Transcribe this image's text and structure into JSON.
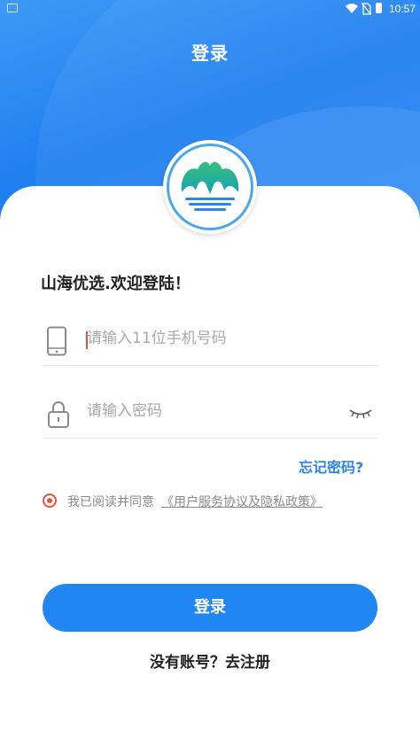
{
  "status_bar": {
    "time": "10:57",
    "icons": [
      "notification-icon",
      "wifi-icon",
      "no-sim-icon",
      "battery-icon"
    ]
  },
  "header": {
    "title": "登录"
  },
  "logo": {
    "icon": "app-logo-icon",
    "colors": {
      "leaf": "#2bb673",
      "wave": "#2a86ef"
    }
  },
  "welcome": "山海优选.欢迎登陆！",
  "form": {
    "phone": {
      "placeholder": "请输入11位手机号码",
      "value": "",
      "icon": "phone-icon"
    },
    "password": {
      "placeholder": "请输入密码",
      "value": "",
      "icon": "lock-icon",
      "toggle_icon": "eye-closed-icon"
    },
    "forgot_label": "忘记密码?",
    "agreement": {
      "checked": true,
      "text": "我已阅读并同意",
      "link": "《用户服务协议及隐私政策》"
    },
    "login_label": "登录",
    "register_label": "没有账号？去注册"
  },
  "colors": {
    "primary": "#1f86f2",
    "accent_red": "#e8533c"
  }
}
